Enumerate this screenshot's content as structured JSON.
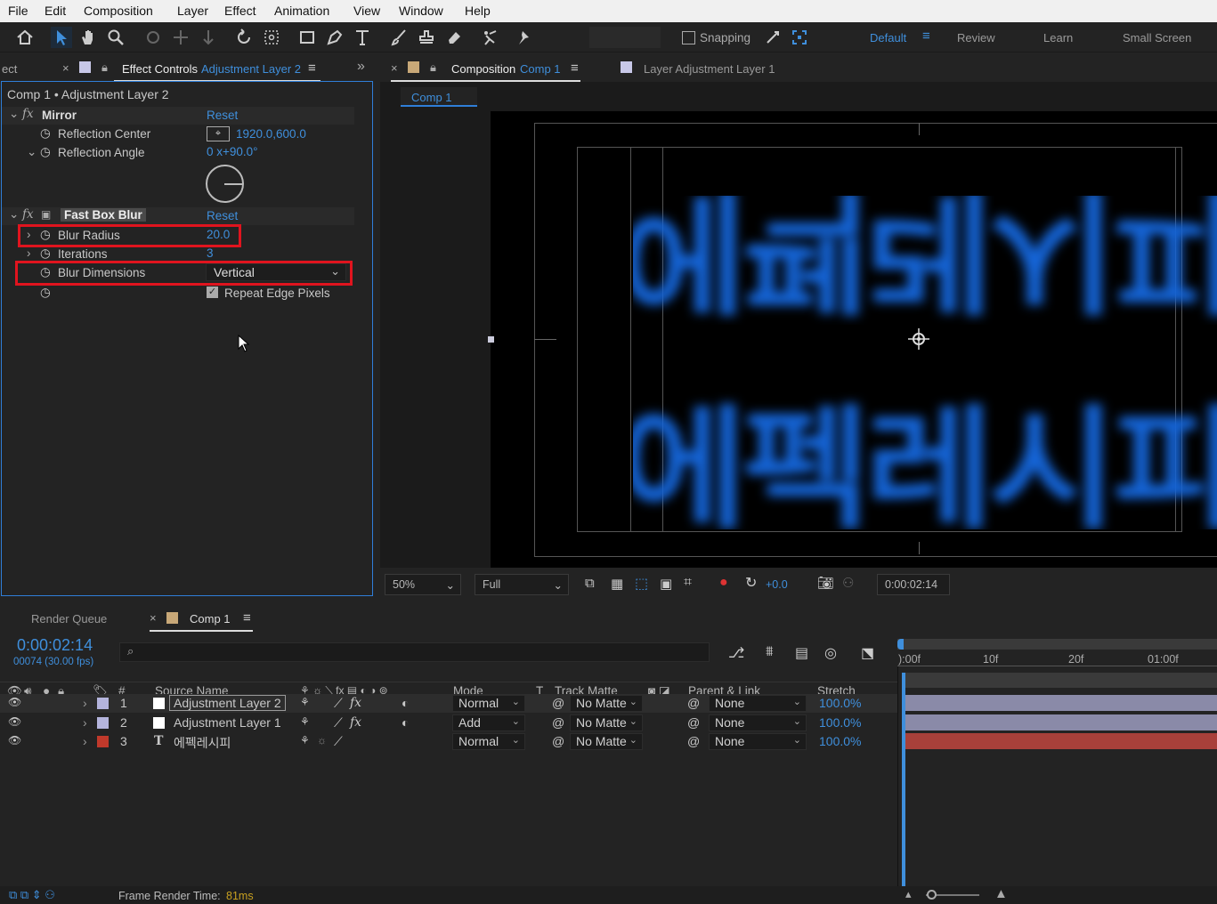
{
  "menu": [
    "File",
    "Edit",
    "Composition",
    "Layer",
    "Effect",
    "Animation",
    "View",
    "Window",
    "Help"
  ],
  "toolbar": {
    "snapping_label": "Snapping"
  },
  "workspaces": {
    "default": "Default",
    "review": "Review",
    "learn": "Learn",
    "small_screen": "Small Screen"
  },
  "effect_controls": {
    "left_tab_fragment": "ect",
    "tab_prefix": "Effect Controls",
    "tab_layer": "Adjustment Layer 2",
    "breadcrumb": "Comp 1 • Adjustment Layer 2",
    "mirror": {
      "name": "Mirror",
      "reset": "Reset",
      "reflection_center_label": "Reflection Center",
      "reflection_center_value": "1920.0,600.0",
      "reflection_angle_label": "Reflection Angle",
      "reflection_angle_value": "0 x+90.0°"
    },
    "fast_box_blur": {
      "name": "Fast Box Blur",
      "reset": "Reset",
      "blur_radius_label": "Blur Radius",
      "blur_radius_value": "20.0",
      "iterations_label": "Iterations",
      "iterations_value": "3",
      "blur_dimensions_label": "Blur Dimensions",
      "blur_dimensions_value": "Vertical",
      "repeat_edge_label": "Repeat Edge Pixels",
      "repeat_edge_checked": true
    }
  },
  "composition_panel": {
    "tab_prefix": "Composition",
    "tab_comp": "Comp 1",
    "layer_tab": "Layer  Adjustment Layer 1",
    "subtab": "Comp 1",
    "zoom": "50%",
    "resolution": "Full",
    "exposure": "+0.0",
    "timecode": "0:00:02:14"
  },
  "timeline": {
    "render_queue": "Render Queue",
    "comp_tab": "Comp 1",
    "current_time": "0:00:02:14",
    "frame_info": "00074 (30.00 fps)",
    "search_placeholder": "",
    "headers": {
      "num": "#",
      "source_name": "Source Name",
      "mode": "Mode",
      "t": "T",
      "track_matte": "Track Matte",
      "parent": "Parent & Link",
      "stretch": "Stretch"
    },
    "ruler": [
      "):00f",
      "10f",
      "20f",
      "01:00f"
    ],
    "layers": [
      {
        "num": "1",
        "name": "Adjustment Layer 2",
        "mode": "Normal",
        "matte": "No Matte",
        "parent": "None",
        "stretch": "100.0%",
        "label_color": "#b4b4dc",
        "bar_color": "#8a8aa8"
      },
      {
        "num": "2",
        "name": "Adjustment Layer 1",
        "mode": "Add",
        "matte": "No Matte",
        "parent": "None",
        "stretch": "100.0%",
        "label_color": "#b4b4dc",
        "bar_color": "#8a8aa8"
      },
      {
        "num": "3",
        "name": "에펙레시피",
        "mode": "Normal",
        "matte": "No Matte",
        "parent": "None",
        "stretch": "100.0%",
        "label_color": "#c0392b",
        "bar_color": "#a8403a"
      }
    ],
    "status": "Frame Render Time:",
    "status_value": "81ms"
  },
  "viewer_text": {
    "top": "에펙레시피",
    "bottom": "에펙레시피"
  },
  "colors": {
    "accent": "#3f8fdc",
    "highlight_box": "#e0141e",
    "text_blue": "#1565d8"
  }
}
